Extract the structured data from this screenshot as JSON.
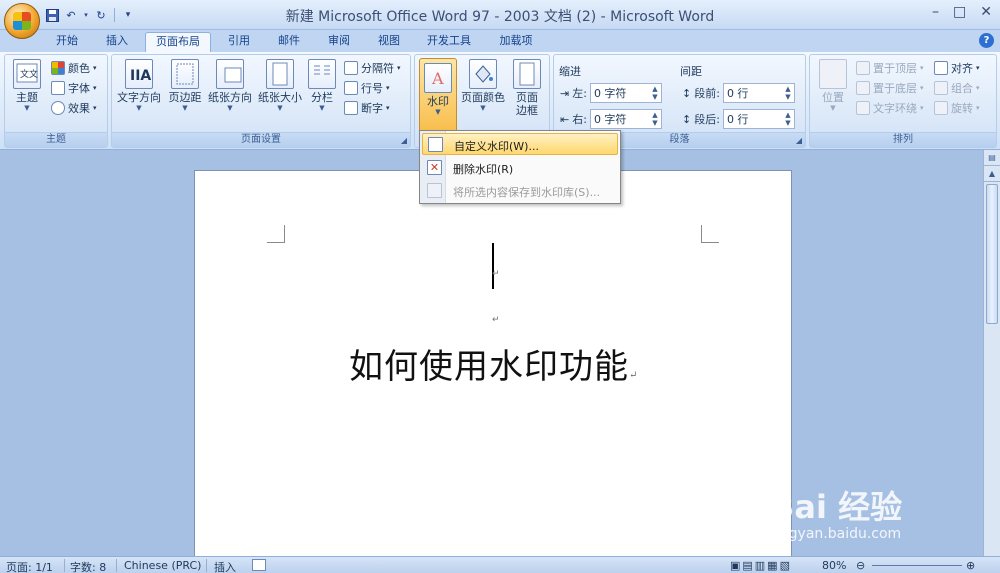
{
  "window": {
    "title": "新建 Microsoft Office Word 97 - 2003 文档 (2) - Microsoft Word",
    "controls": {
      "minimize": "–",
      "maximize": "□",
      "close": "✕"
    }
  },
  "quick_access": {
    "save": "save-icon",
    "undo": "undo-icon",
    "redo": "redo-icon",
    "customize": "▾"
  },
  "tabs": [
    {
      "label": "开始"
    },
    {
      "label": "插入"
    },
    {
      "label": "页面布局"
    },
    {
      "label": "引用"
    },
    {
      "label": "邮件"
    },
    {
      "label": "审阅"
    },
    {
      "label": "视图"
    },
    {
      "label": "开发工具"
    },
    {
      "label": "加载项"
    }
  ],
  "ribbon": {
    "theme_group": {
      "label": "主题",
      "theme_button": "主题",
      "colors": "颜色",
      "fonts": "字体",
      "effects": "效果"
    },
    "page_setup_group": {
      "label": "页面设置",
      "text_direction": "文字方向",
      "margins": "页边距",
      "orientation": "纸张方向",
      "size": "纸张大小",
      "columns": "分栏",
      "breaks": "分隔符",
      "line_numbers": "行号",
      "hyphenation": "断字"
    },
    "page_background_group": {
      "watermark": "水印",
      "page_color": "页面颜色",
      "page_borders_1": "页面",
      "page_borders_2": "边框"
    },
    "paragraph_group": {
      "label": "段落",
      "indent_title": "缩进",
      "indent_left_label": "左:",
      "indent_left_value": "0 字符",
      "indent_right_label": "右:",
      "indent_right_value": "0 字符",
      "spacing_title": "间距",
      "spacing_before_label": "段前:",
      "spacing_before_value": "0 行",
      "spacing_after_label": "段后:",
      "spacing_after_value": "0 行"
    },
    "arrange_group": {
      "label": "排列",
      "position": "位置",
      "bring_front": "置于顶层",
      "send_back": "置于底层",
      "text_wrap": "文字环绕",
      "align": "对齐",
      "group": "组合",
      "rotate": "旋转"
    }
  },
  "watermark_menu": {
    "items": [
      {
        "label": "自定义水印(W)...",
        "state": "hover"
      },
      {
        "label": "删除水印(R)",
        "state": "normal"
      },
      {
        "label": "将所选内容保存到水印库(S)...",
        "state": "disabled"
      }
    ]
  },
  "document": {
    "body_text": "如何使用水印功能",
    "para_mark": "↵"
  },
  "status_bar": {
    "page": "页面: 1/1",
    "words": "字数: 8",
    "language": "Chinese (PRC)",
    "insert_mode": "插入",
    "zoom": "80%"
  },
  "baidu_watermark": {
    "main": "Bai 经验",
    "sub": "jingyan.baidu.com"
  }
}
